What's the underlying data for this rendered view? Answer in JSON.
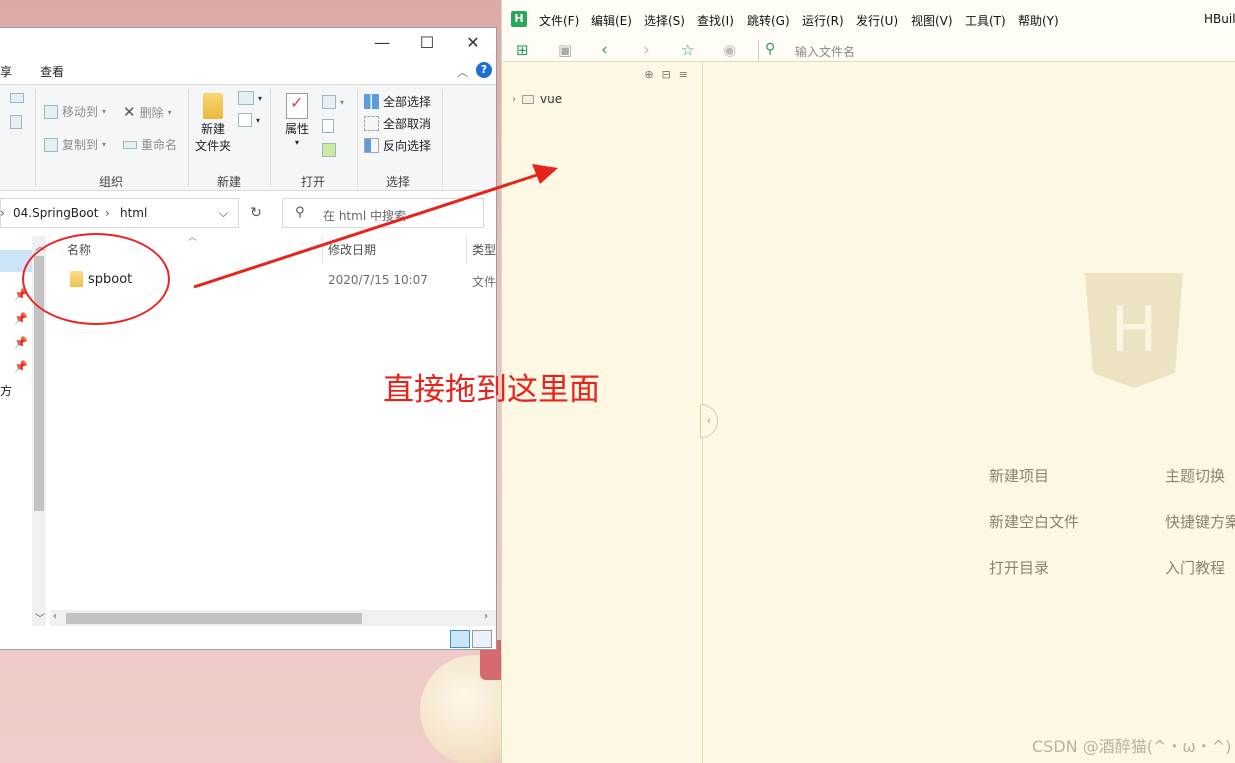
{
  "explorer": {
    "tabs": [
      "享",
      "查看"
    ],
    "ribbon": {
      "organize": {
        "label": "组织",
        "move_to": "移动到",
        "copy_to": "复制到",
        "delete": "删除",
        "rename": "重命名"
      },
      "new": {
        "label": "新建",
        "new_folder_line1": "新建",
        "new_folder_line2": "文件夹"
      },
      "open": {
        "label": "打开",
        "properties": "属性"
      },
      "select": {
        "label": "选择",
        "select_all": "全部选择",
        "select_none": "全部取消",
        "invert": "反向选择"
      }
    },
    "address": {
      "segment1": "04.SpringBoot",
      "segment2": "html"
    },
    "search_placeholder": "在 html 中搜索",
    "nav_partial_text": "方",
    "columns": {
      "name": "名称",
      "date": "修改日期",
      "type": "类型"
    },
    "files": [
      {
        "name": "spboot",
        "date": "2020/7/15 10:07",
        "type": "文件"
      }
    ]
  },
  "hbuilder": {
    "app_name": "HBuil",
    "menu": [
      "文件(F)",
      "编辑(E)",
      "选择(S)",
      "查找(I)",
      "跳转(G)",
      "运行(R)",
      "发行(U)",
      "视图(V)",
      "工具(T)",
      "帮助(Y)"
    ],
    "file_search_placeholder": "输入文件名",
    "tree": [
      {
        "label": "vue"
      }
    ],
    "welcome": {
      "new_project": "新建项目",
      "theme_switch": "主题切换",
      "new_blank_file": "新建空白文件",
      "shortcut_scheme": "快捷键方案",
      "open_dir": "打开目录",
      "tutorial": "入门教程"
    },
    "shield_letter": "H"
  },
  "annotation": "直接拖到这里面",
  "watermark": "CSDN @酒醉猫(^・ω・^)",
  "colors": {
    "annotation_red": "#e8231b",
    "hbuilder_bg": "#fdf8e4",
    "hbuilder_green": "#2aa85a"
  }
}
